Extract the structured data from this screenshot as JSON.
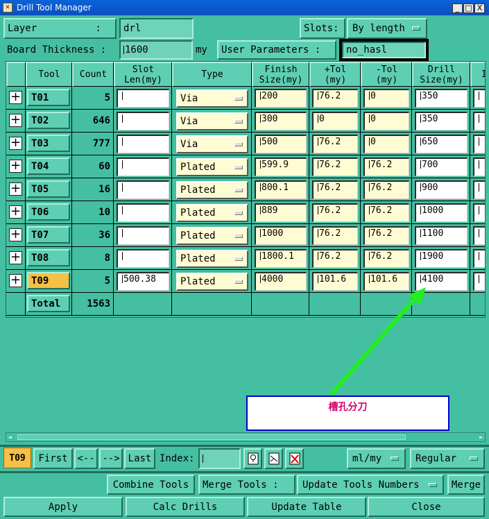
{
  "window": {
    "title": "Drill Tool Manager",
    "minimize": "_",
    "maximize": "□",
    "close": "X"
  },
  "top": {
    "layer_label": "Layer          :",
    "layer_value": "drl",
    "slots_label": "Slots:",
    "slots_value": "By length",
    "board_thickness_label": "Board Thickness :",
    "board_thickness_value": "1600",
    "board_thickness_unit": "my",
    "user_params_label": "User Parameters :",
    "user_params_value": "no_hasl"
  },
  "table": {
    "headers": {
      "tool": "Tool",
      "count": "Count",
      "slot_len": "Slot\nLen(my)",
      "type": "Type",
      "finish": "Finish\nSize(my)",
      "ptol": "+Tol\n(my)",
      "mtol": "-Tol\n(my)",
      "drill": "Drill\nSize(my)",
      "extra": "I"
    },
    "rows": [
      {
        "tool": "T01",
        "count": "5",
        "slot": "",
        "type": "Via",
        "finish": "200",
        "ptol": "76.2",
        "mtol": "0",
        "drill": "350"
      },
      {
        "tool": "T02",
        "count": "646",
        "slot": "",
        "type": "Via",
        "finish": "300",
        "ptol": "0",
        "mtol": "0",
        "drill": "350"
      },
      {
        "tool": "T03",
        "count": "777",
        "slot": "",
        "type": "Via",
        "finish": "500",
        "ptol": "76.2",
        "mtol": "0",
        "drill": "650"
      },
      {
        "tool": "T04",
        "count": "60",
        "slot": "",
        "type": "Plated",
        "finish": "599.9",
        "ptol": "76.2",
        "mtol": "76.2",
        "drill": "700"
      },
      {
        "tool": "T05",
        "count": "16",
        "slot": "",
        "type": "Plated",
        "finish": "800.1",
        "ptol": "76.2",
        "mtol": "76.2",
        "drill": "900"
      },
      {
        "tool": "T06",
        "count": "10",
        "slot": "",
        "type": "Plated",
        "finish": "889",
        "ptol": "76.2",
        "mtol": "76.2",
        "drill": "1000"
      },
      {
        "tool": "T07",
        "count": "36",
        "slot": "",
        "type": "Plated",
        "finish": "1000",
        "ptol": "76.2",
        "mtol": "76.2",
        "drill": "1100"
      },
      {
        "tool": "T08",
        "count": "8",
        "slot": "",
        "type": "Plated",
        "finish": "1800.1",
        "ptol": "76.2",
        "mtol": "76.2",
        "drill": "1900"
      },
      {
        "tool": "T09",
        "count": "5",
        "slot": "500.38",
        "type": "Plated",
        "finish": "4000",
        "ptol": "101.6",
        "mtol": "101.6",
        "drill": "4100"
      }
    ],
    "total_label": "Total",
    "total_count": "1563",
    "selected_color": "#f6c046"
  },
  "annotation": {
    "text": "槽孔分刀",
    "arrow_color": "#22ee22",
    "text_color": "#d0006a"
  },
  "nav": {
    "current": "T09",
    "first": "First",
    "prev": "<--",
    "next": "-->",
    "last": "Last",
    "index_label": "Index:",
    "index_value": "",
    "units": "ml/my",
    "mode": "Regular"
  },
  "actions": {
    "combine": "Combine Tools",
    "merge_label": "Merge Tools :",
    "merge_option": "Update Tools Numbers",
    "merge_btn": "Merge",
    "apply": "Apply",
    "calc": "Calc Drills",
    "update": "Update Table",
    "close": "Close"
  },
  "colors": {
    "panel": "#45bfa1",
    "button": "#5ecfb3",
    "field_yellow": "#fffbd2",
    "title": "#0a5ad0"
  }
}
